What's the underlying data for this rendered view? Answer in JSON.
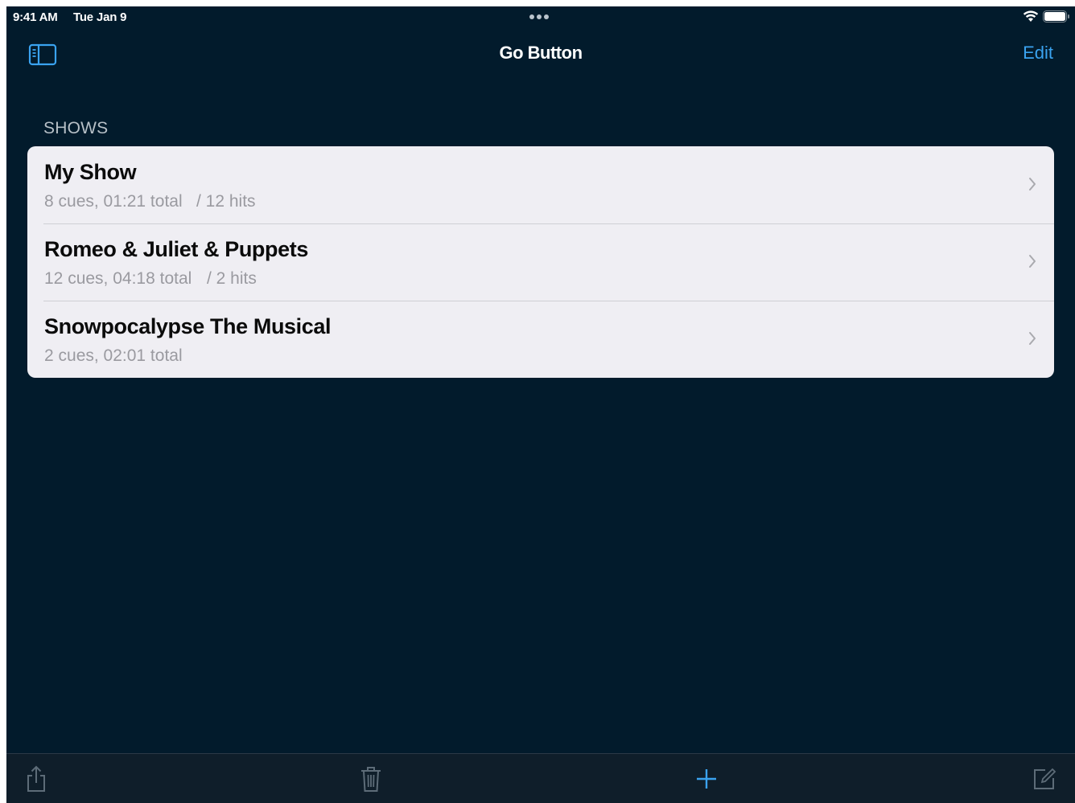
{
  "status_bar": {
    "time": "9:41 AM",
    "date": "Tue Jan 9"
  },
  "nav": {
    "title": "Go Button",
    "edit_label": "Edit"
  },
  "sections": {
    "shows_header": "SHOWS"
  },
  "shows": [
    {
      "title": "My Show",
      "detail": "8 cues, 01:21 total",
      "hits": "/  12 hits"
    },
    {
      "title": "Romeo & Juliet & Puppets",
      "detail": "12 cues, 04:18 total",
      "hits": "/  2 hits"
    },
    {
      "title": "Snowpocalypse The Musical",
      "detail": "2 cues, 02:01 total",
      "hits": ""
    }
  ],
  "icons": {
    "sidebar_toggle": "sidebar-icon",
    "share": "share-icon",
    "trash": "trash-icon",
    "add": "plus-icon",
    "compose": "compose-icon"
  },
  "colors": {
    "accent": "#3aa3f0",
    "background": "#021b2c",
    "row_background": "#efeef3"
  }
}
